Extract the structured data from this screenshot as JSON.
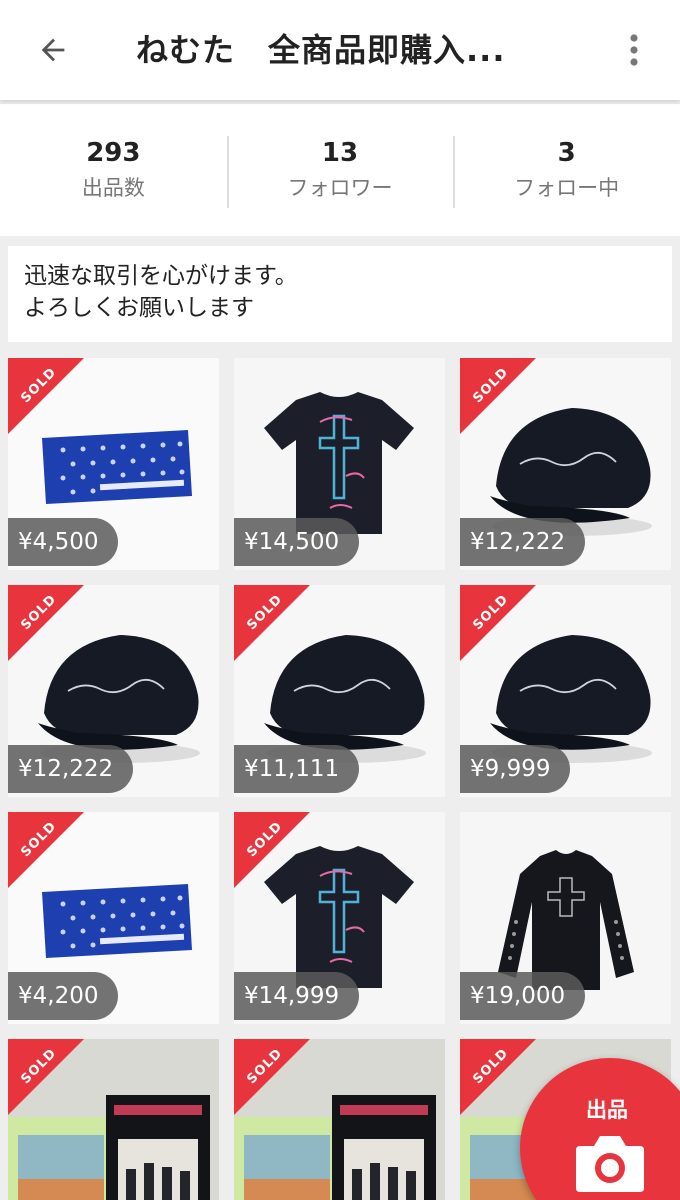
{
  "header": {
    "title": "ねむた　全商品即購入...",
    "back_icon": "arrow-back-icon",
    "more_icon": "more-vertical-icon"
  },
  "stats": [
    {
      "value": "293",
      "label": "出品数"
    },
    {
      "value": "13",
      "label": "フォロワー"
    },
    {
      "value": "3",
      "label": "フォロー中"
    }
  ],
  "bio": {
    "line1": "迅速な取引を心がけます。",
    "line2": "よろしくお願いします"
  },
  "sold_label": "SOLD",
  "items": [
    {
      "kind": "towel",
      "sold": true,
      "price": "¥4,500"
    },
    {
      "kind": "tshirt",
      "sold": false,
      "price": "¥14,500"
    },
    {
      "kind": "cap",
      "sold": true,
      "price": "¥12,222"
    },
    {
      "kind": "cap",
      "sold": true,
      "price": "¥12,222"
    },
    {
      "kind": "cap",
      "sold": true,
      "price": "¥11,111"
    },
    {
      "kind": "cap",
      "sold": true,
      "price": "¥9,999"
    },
    {
      "kind": "towel",
      "sold": true,
      "price": "¥4,200"
    },
    {
      "kind": "tshirt",
      "sold": true,
      "price": "¥14,999"
    },
    {
      "kind": "longsleeve",
      "sold": false,
      "price": "¥19,000"
    },
    {
      "kind": "cd",
      "sold": true,
      "price": ""
    },
    {
      "kind": "cd",
      "sold": true,
      "price": ""
    },
    {
      "kind": "cd",
      "sold": true,
      "price": ""
    }
  ],
  "sell_button": {
    "label": "出品",
    "icon": "camera-icon"
  },
  "colors": {
    "accent": "#e8353d",
    "price_bg": "#5a5a5a"
  }
}
